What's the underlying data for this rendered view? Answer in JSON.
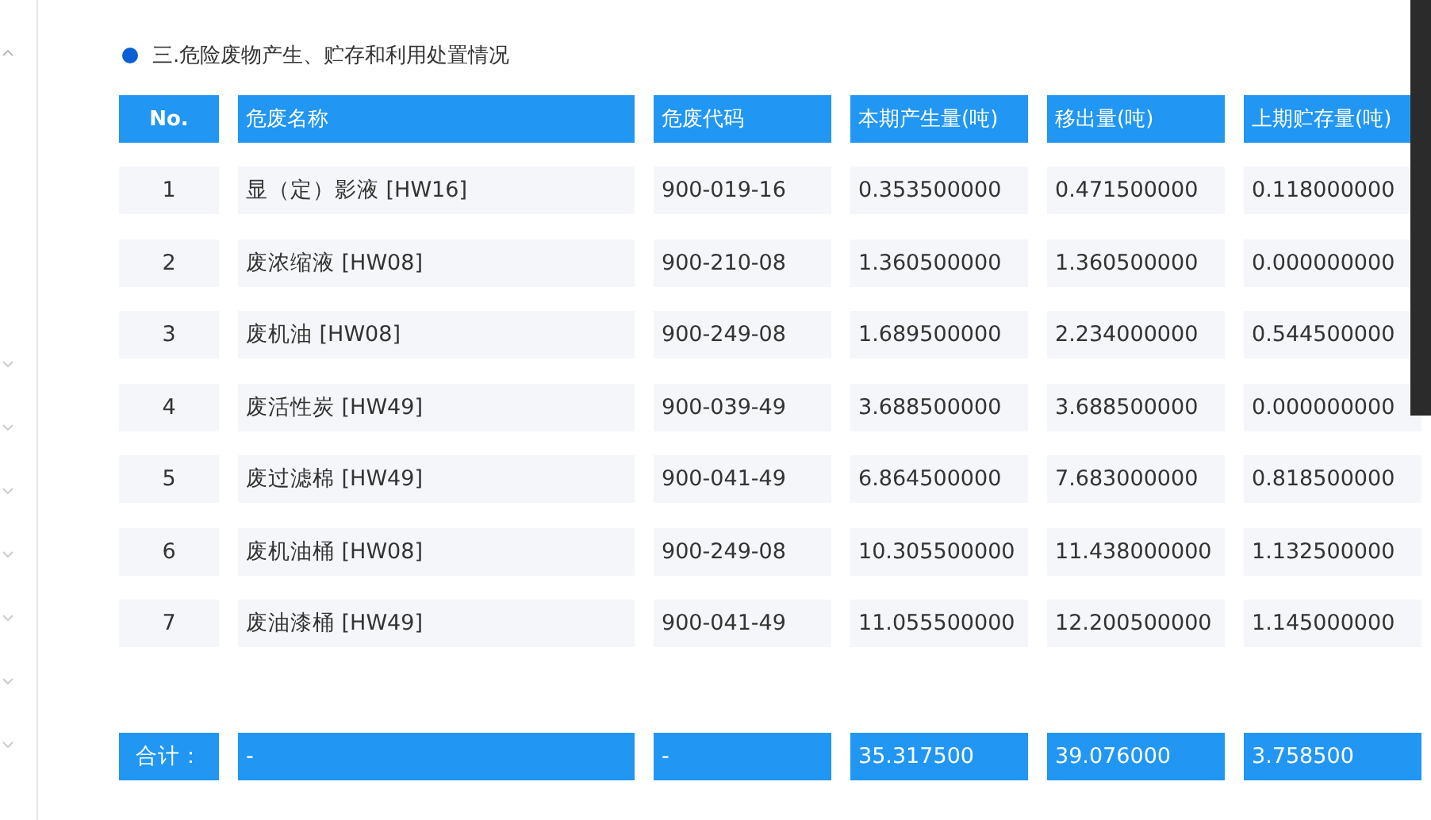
{
  "section": {
    "title": "三.危险废物产生、贮存和利用处置情况"
  },
  "table": {
    "columns": [
      "No.",
      "危废名称",
      "危废代码",
      "本期产生量(吨)",
      "移出量(吨)",
      "上期贮存量(吨)"
    ],
    "rows": [
      [
        "1",
        "显（定）影液 [HW16]",
        "900-019-16",
        "0.353500000",
        "0.471500000",
        "0.118000000"
      ],
      [
        "2",
        "废浓缩液 [HW08]",
        "900-210-08",
        "1.360500000",
        "1.360500000",
        "0.000000000"
      ],
      [
        "3",
        "废机油 [HW08]",
        "900-249-08",
        "1.689500000",
        "2.234000000",
        "0.544500000"
      ],
      [
        "4",
        "废活性炭 [HW49]",
        "900-039-49",
        "3.688500000",
        "3.688500000",
        "0.000000000"
      ],
      [
        "5",
        "废过滤棉 [HW49]",
        "900-041-49",
        "6.864500000",
        "7.683000000",
        "0.818500000"
      ],
      [
        "6",
        "废机油桶 [HW08]",
        "900-249-08",
        "10.305500000",
        "11.438000000",
        "1.132500000"
      ],
      [
        "7",
        "废油漆桶 [HW49]",
        "900-041-49",
        "11.055500000",
        "12.200500000",
        "1.145000000"
      ]
    ],
    "totals": [
      "合计：",
      "-",
      "-",
      "35.317500",
      "39.076000",
      "3.758500"
    ]
  }
}
